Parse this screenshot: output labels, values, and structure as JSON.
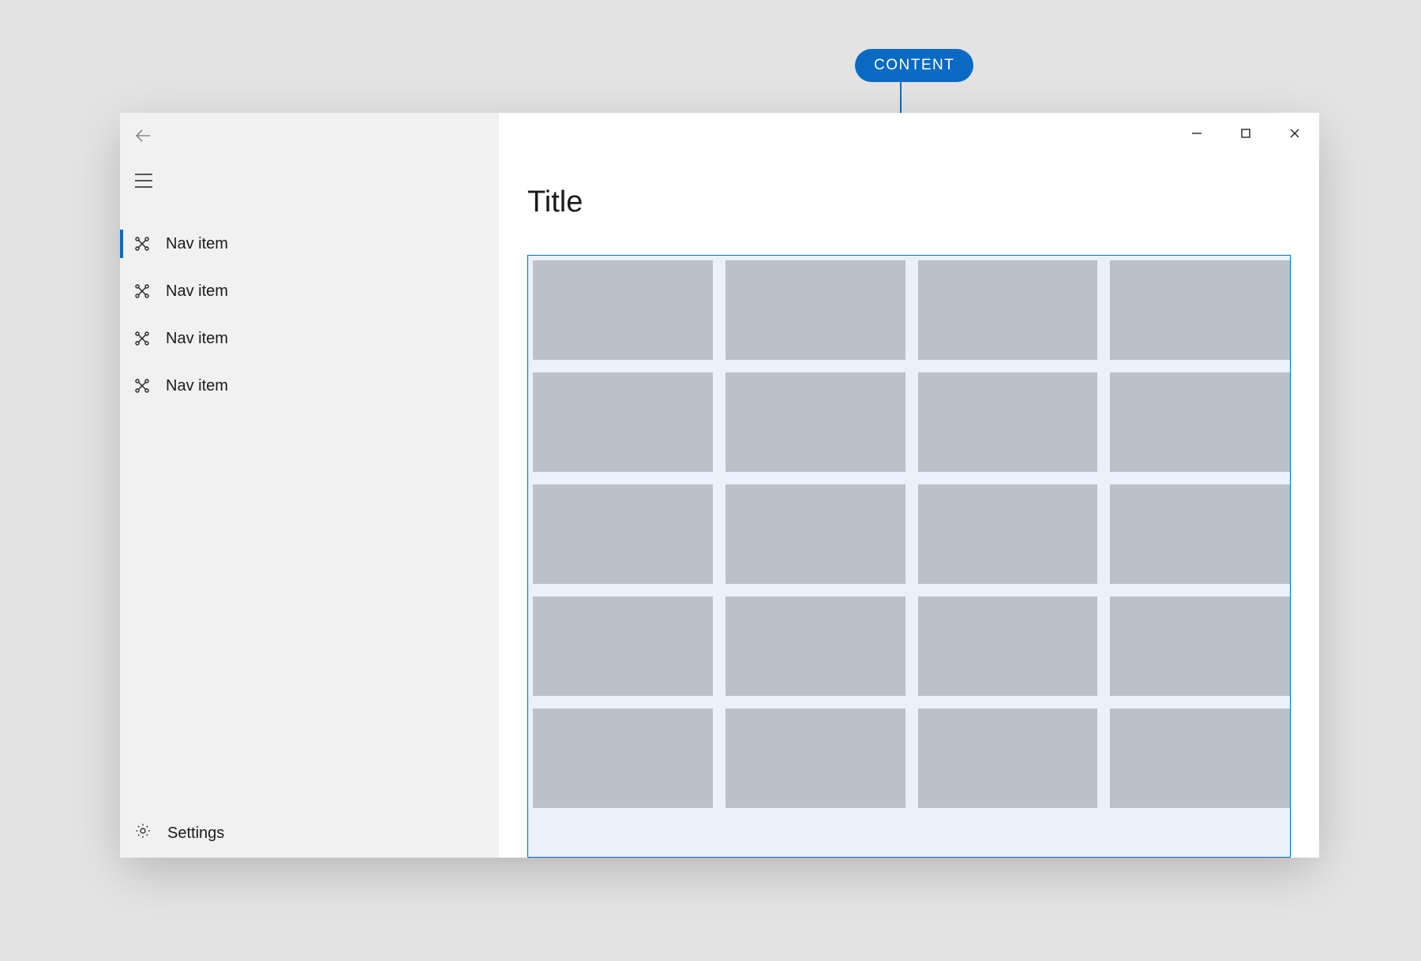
{
  "annotation": {
    "label": "CONTENT"
  },
  "page": {
    "title": "Title"
  },
  "sidebar": {
    "items": [
      {
        "label": "Nav item",
        "selected": true
      },
      {
        "label": "Nav item",
        "selected": false
      },
      {
        "label": "Nav item",
        "selected": false
      },
      {
        "label": "Nav item",
        "selected": false
      }
    ],
    "settings_label": "Settings"
  },
  "content": {
    "grid_columns": 4,
    "grid_rows_visible": 5
  },
  "colors": {
    "accent": "#0a6ac3",
    "sidebar_bg": "#f1f1f1",
    "tile": "#bac1c9",
    "content_bg": "#eaf1fb"
  }
}
